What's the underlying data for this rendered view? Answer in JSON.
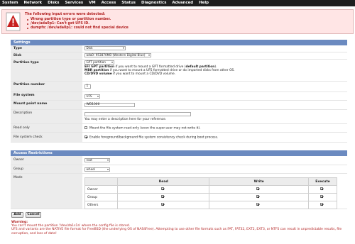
{
  "nav": [
    "System",
    "Network",
    "Disks",
    "Services",
    "VM",
    "Access",
    "Status",
    "Diagnostics",
    "Advanced",
    "Help"
  ],
  "error": {
    "title": "The following input errors were detected:",
    "items": [
      "Wrong partition type or partition number.",
      "/dev/ada0p1: Can't get UFS ID.",
      "dumpfs: /dev/ada0p1: could not find special device"
    ]
  },
  "settings": {
    "header": "Settings",
    "type": {
      "label": "Type",
      "value": "Disk"
    },
    "disk": {
      "label": "Disk",
      "value": "ada0: 953870MB (Western Digital Blue)"
    },
    "partition_type": {
      "label": "Partition type",
      "value": "GPT partition",
      "help1_bold": "EFI GPT partition",
      "help1_rest": " if you want to mount a GPT formatted drive (",
      "help1_bold2": "default partition",
      "help1_end": ").",
      "help2_bold": "MBR partition",
      "help2_rest": " if you want to mount a UFS formatted drive or do imported disks from other OS.",
      "help3_bold": "CD/DVD volume",
      "help3_rest": " if you want to mount a CD/DVD volume."
    },
    "partition_number": {
      "label": "Partition number",
      "value": "1"
    },
    "file_system": {
      "label": "File system",
      "value": "UFS"
    },
    "mount_point": {
      "label": "Mount point name",
      "value": "WD1000"
    },
    "description": {
      "label": "Description",
      "value": "",
      "help": "You may enter a description here for your reference."
    },
    "read_only": {
      "label": "Read only",
      "text": "Mount the file system read-only (even the super-user may not write it).",
      "checked": false
    },
    "fs_check": {
      "label": "File system check",
      "text": "Enable foreground/background file system consistency check during boot process.",
      "checked": true
    }
  },
  "access": {
    "header": "Access Restrictions",
    "owner": {
      "label": "Owner",
      "value": "root"
    },
    "group": {
      "label": "Group",
      "value": "wheel"
    },
    "mode": {
      "label": "Mode",
      "columns": [
        "Read",
        "Write",
        "Execute"
      ],
      "rows": [
        {
          "name": "Owner",
          "read": true,
          "write": true,
          "execute": true
        },
        {
          "name": "Group",
          "read": true,
          "write": true,
          "execute": true
        },
        {
          "name": "Others",
          "read": true,
          "write": true,
          "execute": true
        }
      ]
    }
  },
  "buttons": {
    "add": "Add",
    "cancel": "Cancel"
  },
  "warning": {
    "title": "Warning:",
    "line1": "You can't mount the partition '/dev/da1s1a' where the config file is stored.",
    "line2": "UFS and variants are the NATIVE file format for FreeBSD (the underlying OS of NAS4Free). Attempting to use other file formats such as FAT, FAT32, EXT2, EXT3, or NTFS can result in unpredictable results, file corruption, and loss of data!"
  },
  "colors": {
    "nav_bg": "#1f1f1f",
    "section_header": "#6b8ac0",
    "error_bg": "#ffe5e5",
    "error_text": "#b22222"
  }
}
